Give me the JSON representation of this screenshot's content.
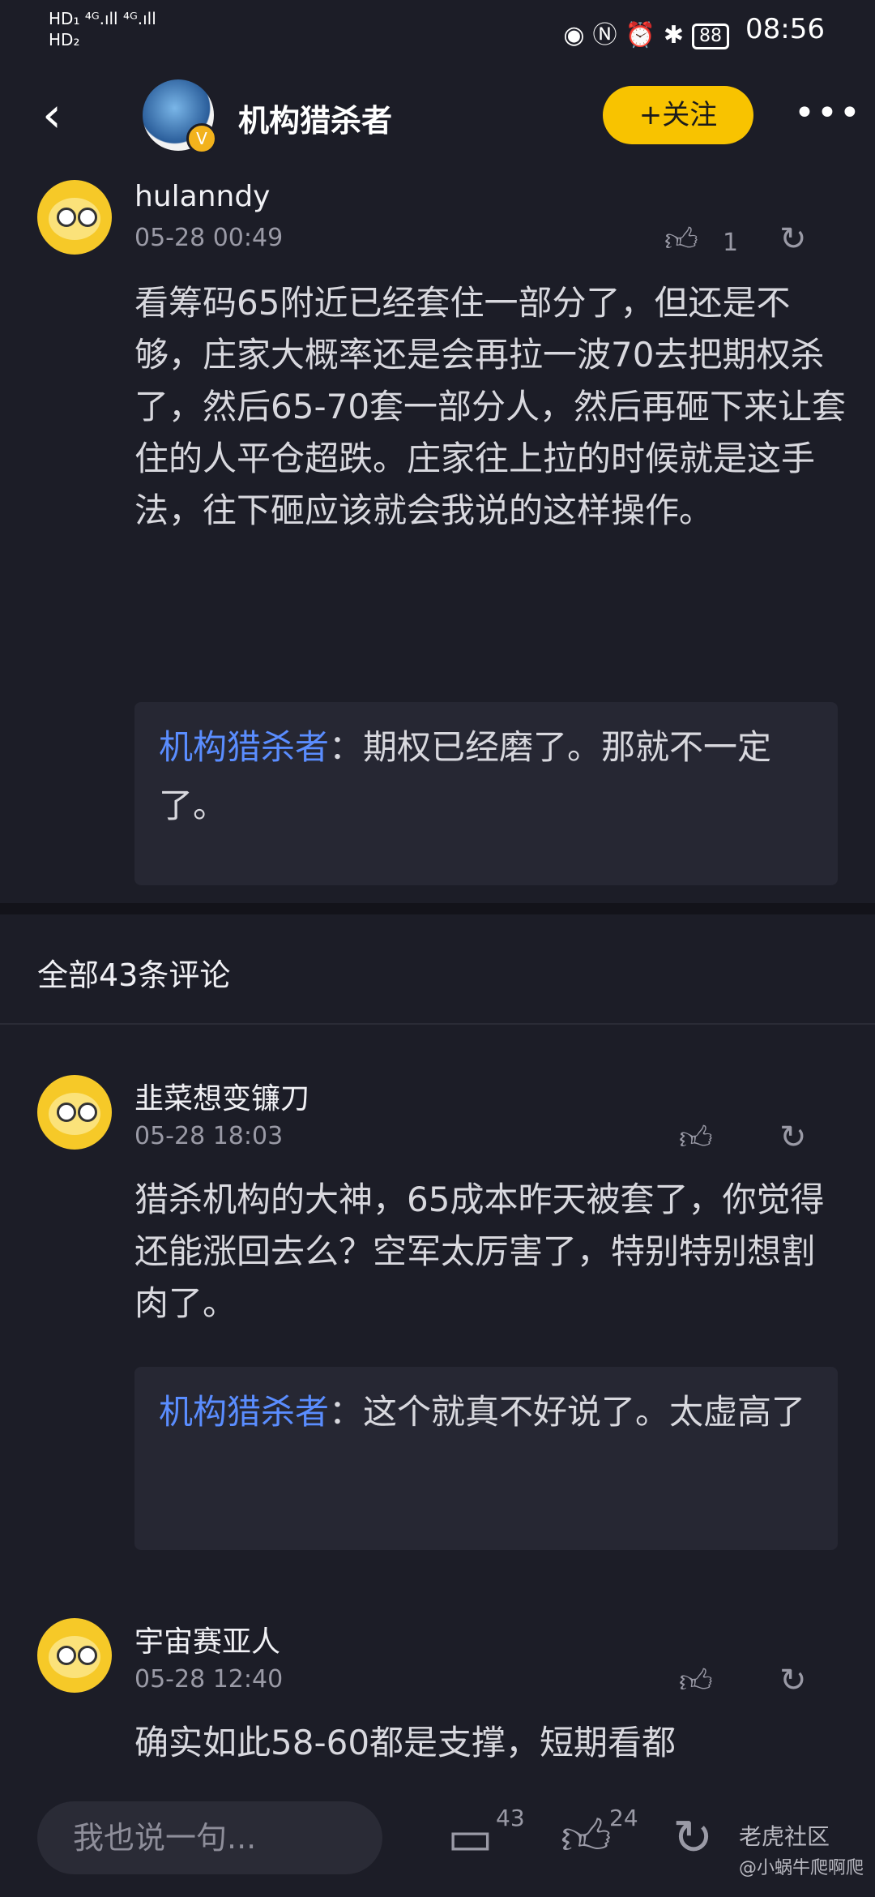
{
  "status_bar": {
    "left_top": "HD₁ ⁴ᴳ.ıll ⁴ᴳ.ıll",
    "left_bottom": "HD₂",
    "battery": "88",
    "time": "08:56"
  },
  "nav": {
    "title": "机构猎杀者",
    "follow_label": "+关注"
  },
  "top_comment": {
    "user": "hulanndy",
    "date": "05-28 00:49",
    "likes": "1",
    "text": "看筹码65附近已经套住一部分了，但还是不够，庄家大概率还是会再拉一波70去把期权杀了，然后65-70套一部分人，然后再砸下来让套住的人平仓超跌。庄家往上拉的时候就是这手法，往下砸应该就会我说的这样操作。",
    "reply_name": "机构猎杀者",
    "reply_text": "：期权已经磨了。那就不一定了。"
  },
  "section_title": "全部43条评论",
  "comments": [
    {
      "user": "韭菜想变镰刀",
      "date": "05-28 18:03",
      "text": "猎杀机构的大神，65成本昨天被套了，你觉得还能涨回去么？空军太厉害了，特别特别想割肉了。",
      "reply_name": "机构猎杀者",
      "reply_text": "：这个就真不好说了。太虚高了"
    },
    {
      "user": "宇宙赛亚人",
      "date": "05-28 12:40",
      "text": "确实如此58-60都是支撑，短期看都"
    }
  ],
  "bottom": {
    "placeholder": "我也说一句...",
    "comment_count": "43",
    "like_count": "24",
    "watermark_top": "老虎社区",
    "watermark_bottom": "@小蜗牛爬啊爬"
  }
}
